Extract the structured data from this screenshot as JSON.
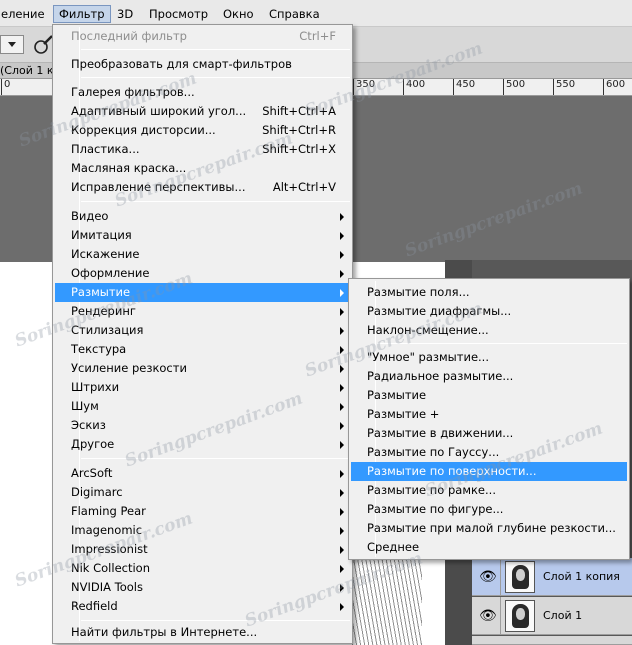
{
  "menubar": {
    "items": [
      {
        "label": "еление"
      },
      {
        "label": "Фильтр"
      },
      {
        "label": "3D"
      },
      {
        "label": "Просмотр"
      },
      {
        "label": "Окно"
      },
      {
        "label": "Справка"
      }
    ]
  },
  "document": {
    "tab_label": "(Слой 1 к",
    "ruler_ticks": [
      "0",
      "350",
      "400",
      "450",
      "500",
      "550",
      "600"
    ]
  },
  "filter_menu": {
    "items": [
      {
        "label": "Последний фильтр",
        "shortcut": "Ctrl+F"
      },
      {
        "label": "Преобразовать для смарт-фильтров"
      },
      {
        "label": "Галерея фильтров..."
      },
      {
        "label": "Адаптивный широкий угол...",
        "shortcut": "Shift+Ctrl+A"
      },
      {
        "label": "Коррекция дисторсии...",
        "shortcut": "Shift+Ctrl+R"
      },
      {
        "label": "Пластика...",
        "shortcut": "Shift+Ctrl+X"
      },
      {
        "label": "Масляная краска..."
      },
      {
        "label": "Исправление перспективы...",
        "shortcut": "Alt+Ctrl+V"
      },
      {
        "label": "Видео"
      },
      {
        "label": "Имитация"
      },
      {
        "label": "Искажение"
      },
      {
        "label": "Оформление"
      },
      {
        "label": "Размытие"
      },
      {
        "label": "Рендеринг"
      },
      {
        "label": "Стилизация"
      },
      {
        "label": "Текстура"
      },
      {
        "label": "Усиление резкости"
      },
      {
        "label": "Штрихи"
      },
      {
        "label": "Шум"
      },
      {
        "label": "Эскиз"
      },
      {
        "label": "Другое"
      },
      {
        "label": "ArcSoft"
      },
      {
        "label": "Digimarc"
      },
      {
        "label": "Flaming Pear"
      },
      {
        "label": "Imagenomic"
      },
      {
        "label": "Impressionist"
      },
      {
        "label": "Nik Collection"
      },
      {
        "label": "NVIDIA Tools"
      },
      {
        "label": "Redfield"
      },
      {
        "label": "Найти фильтры в Интернете..."
      }
    ]
  },
  "blur_menu": {
    "items": [
      {
        "label": "Размытие поля..."
      },
      {
        "label": "Размытие диафрагмы..."
      },
      {
        "label": "Наклон-смещение..."
      },
      {
        "label": "\"Умное\" размытие..."
      },
      {
        "label": "Радиальное размытие..."
      },
      {
        "label": "Размытие"
      },
      {
        "label": "Размытие +"
      },
      {
        "label": "Размытие в движении..."
      },
      {
        "label": "Размытие по Гауссу..."
      },
      {
        "label": "Размытие по поверхности..."
      },
      {
        "label": "Размытие по рамке..."
      },
      {
        "label": "Размытие по фигуре..."
      },
      {
        "label": "Размытие при малой глубине резкости..."
      },
      {
        "label": "Среднее"
      }
    ]
  },
  "layers": [
    {
      "name": "Слой 1 копия",
      "selected": true
    },
    {
      "name": "Слой 1",
      "selected": false
    }
  ],
  "watermark": "Soringpcrepair.com",
  "colors": {
    "highlight": "#3399ff",
    "menu_bg": "#f0f0f0",
    "selected_layer": "#b7c9ec"
  }
}
